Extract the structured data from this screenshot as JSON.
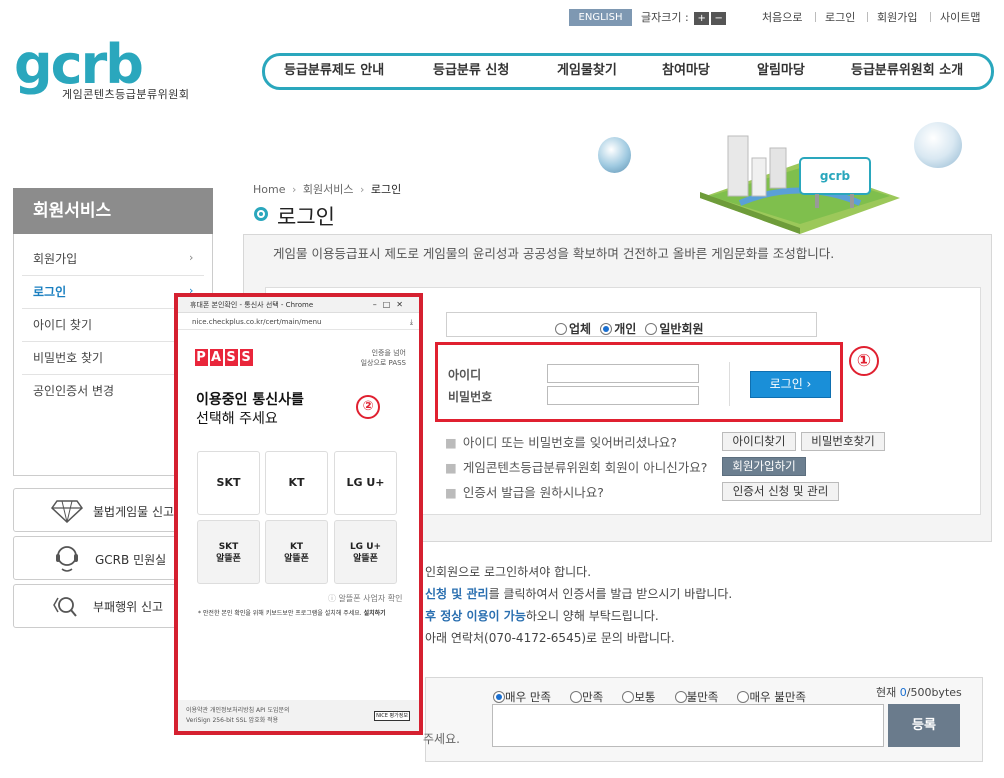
{
  "top": {
    "english": "ENGLISH",
    "font_size_label": "글자크기 :",
    "font_plus": "+",
    "font_minus": "−",
    "links": [
      "처음으로",
      "로그인",
      "회원가입",
      "사이트맵"
    ]
  },
  "logo": {
    "text": "gcrb",
    "sub": "게임콘텐츠등급분류위원회"
  },
  "nav": [
    "등급분류제도 안내",
    "등급분류 신청",
    "게임물찾기",
    "참여마당",
    "알림마당",
    "등급분류위원회 소개"
  ],
  "sidebar": {
    "title": "회원서비스",
    "items": [
      {
        "label": "회원가입",
        "arrow": "›"
      },
      {
        "label": "로그인",
        "arrow": "›"
      },
      {
        "label": "아이디 찾기",
        "arrow": ""
      },
      {
        "label": "비밀번호 찾기",
        "arrow": ""
      },
      {
        "label": "공인인증서 변경",
        "arrow": ""
      }
    ],
    "quick": [
      "불법게임물 신고",
      "GCRB 민원실",
      "부패행위 신고"
    ]
  },
  "breadcrumb": {
    "home": "Home",
    "sep": "›",
    "level1": "회원서비스",
    "current": "로그인"
  },
  "page_title": "로그인",
  "intro": "게임물 이용등급표시 제도로 게임물의 윤리성과 공공성을 확보하며 건전하고 올바른 게임문화를 조성합니다.",
  "login": {
    "types": [
      {
        "label": "업체",
        "selected": false
      },
      {
        "label": "개인",
        "selected": true
      },
      {
        "label": "일반회원",
        "selected": false
      }
    ],
    "id_label": "아이디",
    "pw_label": "비밀번호",
    "id_value": "",
    "pw_value": "",
    "login_button": "로그인  ›",
    "marker": "①"
  },
  "help": [
    {
      "text": "아이디 또는 비밀번호를 잊어버리셨나요?",
      "buttons": [
        "아이디찾기",
        "비밀번호찾기"
      ]
    },
    {
      "text": "게임콘텐츠등급분류위원회 회원이 아니신가요?",
      "buttons": [
        "회원가입하기"
      ]
    },
    {
      "text": "인증서 발급을 원하시나요?",
      "buttons": [
        "인증서 신청 및 관리"
      ]
    }
  ],
  "notes": {
    "line1": "인회원으로 로그인하셔야 합니다.",
    "line2_bold": "신청 및 관리",
    "line2_rest": "를 클릭하여서 인증서를 발급 받으시기 바랍니다.",
    "line3_bold": "후 정상 이용이 가능",
    "line3_rest": "하오니 양해 부탁드립니다.",
    "line4": "아래 연락처(070-4172-6545)로 문의 바랍니다.",
    "line5": "주세요."
  },
  "feedback": {
    "options": [
      {
        "label": "매우 만족",
        "selected": true
      },
      {
        "label": "만족",
        "selected": false
      },
      {
        "label": "보통",
        "selected": false
      },
      {
        "label": "불만족",
        "selected": false
      },
      {
        "label": "매우 불만족",
        "selected": false
      }
    ],
    "count_prefix": "현재 ",
    "count_value": "0",
    "count_suffix": "/500bytes",
    "submit": "등록"
  },
  "popup": {
    "window_title": "휴대폰 본인확인 - 통신사 선택 - Chrome",
    "url": "nice.checkplus.co.kr/cert/main/menu",
    "brand": [
      "P",
      "A",
      "S",
      "S"
    ],
    "tagline_1": "인증을 넘어",
    "tagline_2": "일상으로 PASS",
    "heading_bold": "이용중인 통신사를",
    "heading_rest": "선택해 주세요",
    "marker": "②",
    "carriers": [
      "SKT",
      "KT",
      "LG U+"
    ],
    "mvno": [
      {
        "name": "SKT",
        "sub": "알뜰폰"
      },
      {
        "name": "KT",
        "sub": "알뜰폰"
      },
      {
        "name": "LG U+",
        "sub": "알뜰폰"
      }
    ],
    "mvno_check": "알뜰폰 사업자 확인",
    "security_note": "* 안전한 본인 확인을 위해 키보드보안 프로그램을 설치해 주세요.",
    "install": "설치하기",
    "footer_1": "이용약관  개인정보처리방침  API 도입문의",
    "footer_2": "VeriSign 256-bit SSL 암호화 적용",
    "nice_badge": "NICE 평가정보"
  },
  "colors": {
    "brand": "#2aa7bd",
    "login_blue": "#1a8fd8",
    "red_highlight": "#e02030"
  }
}
